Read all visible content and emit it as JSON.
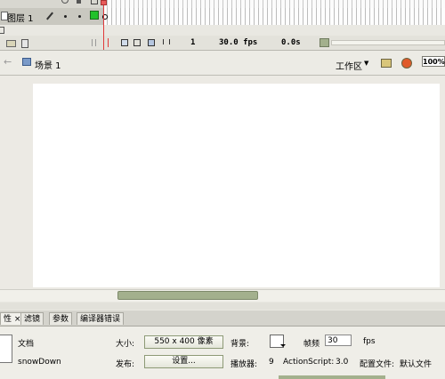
{
  "timeline": {
    "layer_name": "图层 1",
    "frame_number": "1",
    "fps": "30.0 fps",
    "time": "0.0s"
  },
  "scene_bar": {
    "scene_label": "场景 1",
    "workspace_label": "工作区",
    "zoom": "100%"
  },
  "panel": {
    "tabs": [
      "性",
      "滤镜",
      "参数",
      "编译器错误"
    ],
    "doc_type": "文档",
    "doc_name": "snowDown",
    "size_label": "大小:",
    "size_value": "550 x 400 像素",
    "bg_label": "背景:",
    "fps_label": "帧频",
    "fps_value": "30",
    "publish_label": "发布:",
    "settings_button": "设置...",
    "player_label": "播放器:",
    "player_value": "9",
    "as_label": "ActionScript:",
    "as_value": "3.0",
    "profile_label": "配置文件:",
    "profile_value": "默认文件"
  },
  "colors": {
    "timeline_bg": "#c9c8c0",
    "stage": "#ffffff",
    "scroll_thumb": "#a3b08d",
    "keyframe_green": "#22c22a"
  }
}
